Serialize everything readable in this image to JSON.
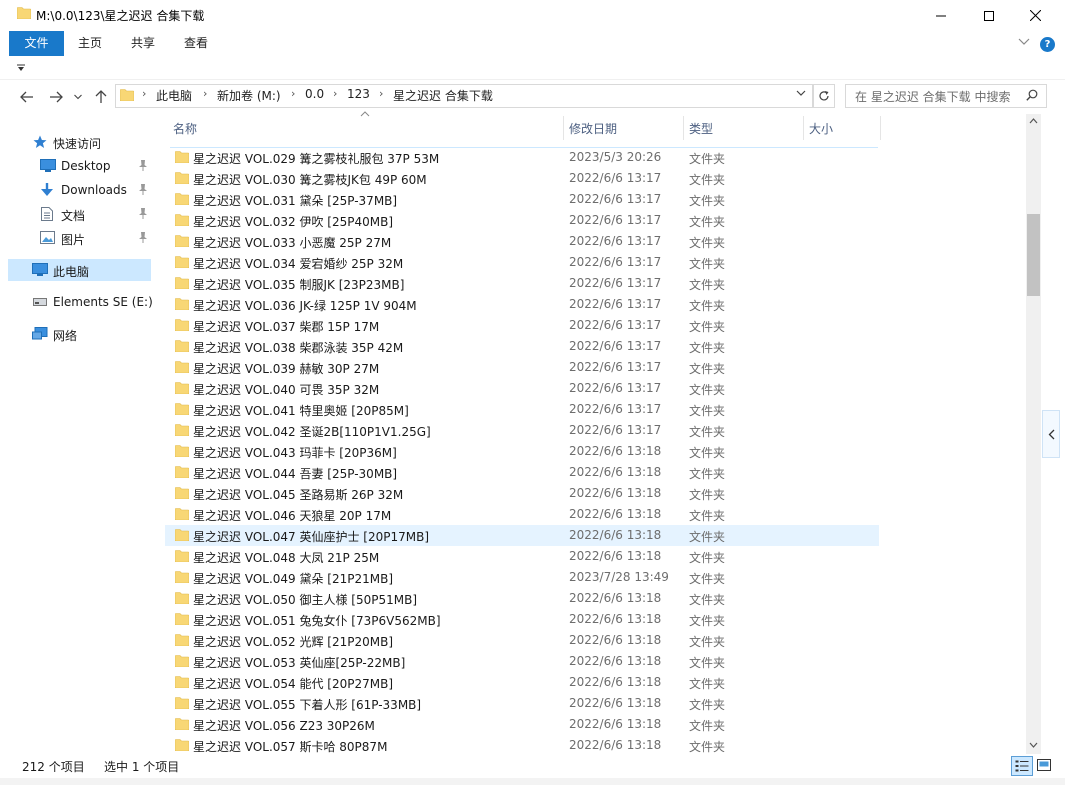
{
  "window": {
    "title": "M:\\0.0\\123\\星之迟迟 合集下载"
  },
  "ribbon": {
    "tabs": [
      "文件",
      "主页",
      "共享",
      "查看"
    ],
    "help": "?"
  },
  "address": {
    "crumbs": [
      "此电脑",
      "新加卷 (M:)",
      "0.0",
      "123",
      "星之迟迟 合集下载"
    ]
  },
  "search": {
    "placeholder": "在 星之迟迟 合集下载 中搜索"
  },
  "sidebar": {
    "quick_access": "快速访问",
    "desktop": "Desktop",
    "downloads": "Downloads",
    "documents": "文档",
    "pictures": "图片",
    "this_pc": "此电脑",
    "drive": "Elements SE (E:)",
    "network": "网络"
  },
  "columns": {
    "name": "名称",
    "date": "修改日期",
    "type": "类型",
    "size": "大小"
  },
  "files": [
    {
      "name": "星之迟迟 VOL.029 篝之雾枝礼服包 37P 53M",
      "date": "2023/5/3 20:26",
      "type": "文件夹"
    },
    {
      "name": "星之迟迟 VOL.030 篝之雾枝JK包 49P 60M",
      "date": "2022/6/6 13:17",
      "type": "文件夹"
    },
    {
      "name": "星之迟迟 VOL.031 黛朵 [25P-37MB]",
      "date": "2022/6/6 13:17",
      "type": "文件夹"
    },
    {
      "name": "星之迟迟 VOL.032 伊吹 [25P40MB]",
      "date": "2022/6/6 13:17",
      "type": "文件夹"
    },
    {
      "name": "星之迟迟 VOL.033 小恶魔 25P 27M",
      "date": "2022/6/6 13:17",
      "type": "文件夹"
    },
    {
      "name": "星之迟迟 VOL.034 爱宕婚纱 25P 32M",
      "date": "2022/6/6 13:17",
      "type": "文件夹"
    },
    {
      "name": "星之迟迟 VOL.035 制服JK [23P23MB]",
      "date": "2022/6/6 13:17",
      "type": "文件夹"
    },
    {
      "name": "星之迟迟 VOL.036 JK-绿 125P 1V 904M",
      "date": "2022/6/6 13:17",
      "type": "文件夹"
    },
    {
      "name": "星之迟迟 VOL.037 柴郡 15P 17M",
      "date": "2022/6/6 13:17",
      "type": "文件夹"
    },
    {
      "name": "星之迟迟 VOL.038 柴郡泳装 35P 42M",
      "date": "2022/6/6 13:17",
      "type": "文件夹"
    },
    {
      "name": "星之迟迟 VOL.039 赫敏 30P 27M",
      "date": "2022/6/6 13:17",
      "type": "文件夹"
    },
    {
      "name": "星之迟迟 VOL.040 可畏 35P 32M",
      "date": "2022/6/6 13:17",
      "type": "文件夹"
    },
    {
      "name": "星之迟迟 VOL.041 特里奥姬 [20P85M]",
      "date": "2022/6/6 13:17",
      "type": "文件夹"
    },
    {
      "name": "星之迟迟 VOL.042 圣诞2B[110P1V1.25G]",
      "date": "2022/6/6 13:17",
      "type": "文件夹"
    },
    {
      "name": "星之迟迟 VOL.043 玛菲卡 [20P36M]",
      "date": "2022/6/6 13:18",
      "type": "文件夹"
    },
    {
      "name": "星之迟迟 VOL.044 吾妻 [25P-30MB]",
      "date": "2022/6/6 13:18",
      "type": "文件夹"
    },
    {
      "name": "星之迟迟 VOL.045 圣路易斯 26P 32M",
      "date": "2022/6/6 13:18",
      "type": "文件夹"
    },
    {
      "name": "星之迟迟 VOL.046 天狼星 20P 17M",
      "date": "2022/6/6 13:18",
      "type": "文件夹"
    },
    {
      "name": "星之迟迟 VOL.047 英仙座护士 [20P17MB]",
      "date": "2022/6/6 13:18",
      "type": "文件夹"
    },
    {
      "name": "星之迟迟 VOL.048 大凤 21P 25M",
      "date": "2022/6/6 13:18",
      "type": "文件夹"
    },
    {
      "name": "星之迟迟 VOL.049 黛朵 [21P21MB]",
      "date": "2023/7/28 13:49",
      "type": "文件夹"
    },
    {
      "name": "星之迟迟 VOL.050 御主人様  [50P51MB]",
      "date": "2022/6/6 13:18",
      "type": "文件夹"
    },
    {
      "name": "星之迟迟 VOL.051 兔兔女仆 [73P6V562MB]",
      "date": "2022/6/6 13:18",
      "type": "文件夹"
    },
    {
      "name": "星之迟迟 VOL.052 光辉 [21P20MB]",
      "date": "2022/6/6 13:18",
      "type": "文件夹"
    },
    {
      "name": "星之迟迟 VOL.053 英仙座[25P-22MB]",
      "date": "2022/6/6 13:18",
      "type": "文件夹"
    },
    {
      "name": "星之迟迟 VOL.054 能代 [20P27MB]",
      "date": "2022/6/6 13:18",
      "type": "文件夹"
    },
    {
      "name": "星之迟迟 VOL.055 下着人形 [61P-33MB]",
      "date": "2022/6/6 13:18",
      "type": "文件夹"
    },
    {
      "name": "星之迟迟 VOL.056 Z23  30P26M",
      "date": "2022/6/6 13:18",
      "type": "文件夹"
    },
    {
      "name": "星之迟迟 VOL.057 斯卡哈  80P87M",
      "date": "2022/6/6 13:18",
      "type": "文件夹"
    }
  ],
  "selected_index": 18,
  "status": {
    "count": "212 个项目",
    "selection": "选中 1 个项目"
  },
  "colors": {
    "accent": "#1979ca",
    "selection": "#e5f3ff",
    "folder": "#f8d775"
  }
}
